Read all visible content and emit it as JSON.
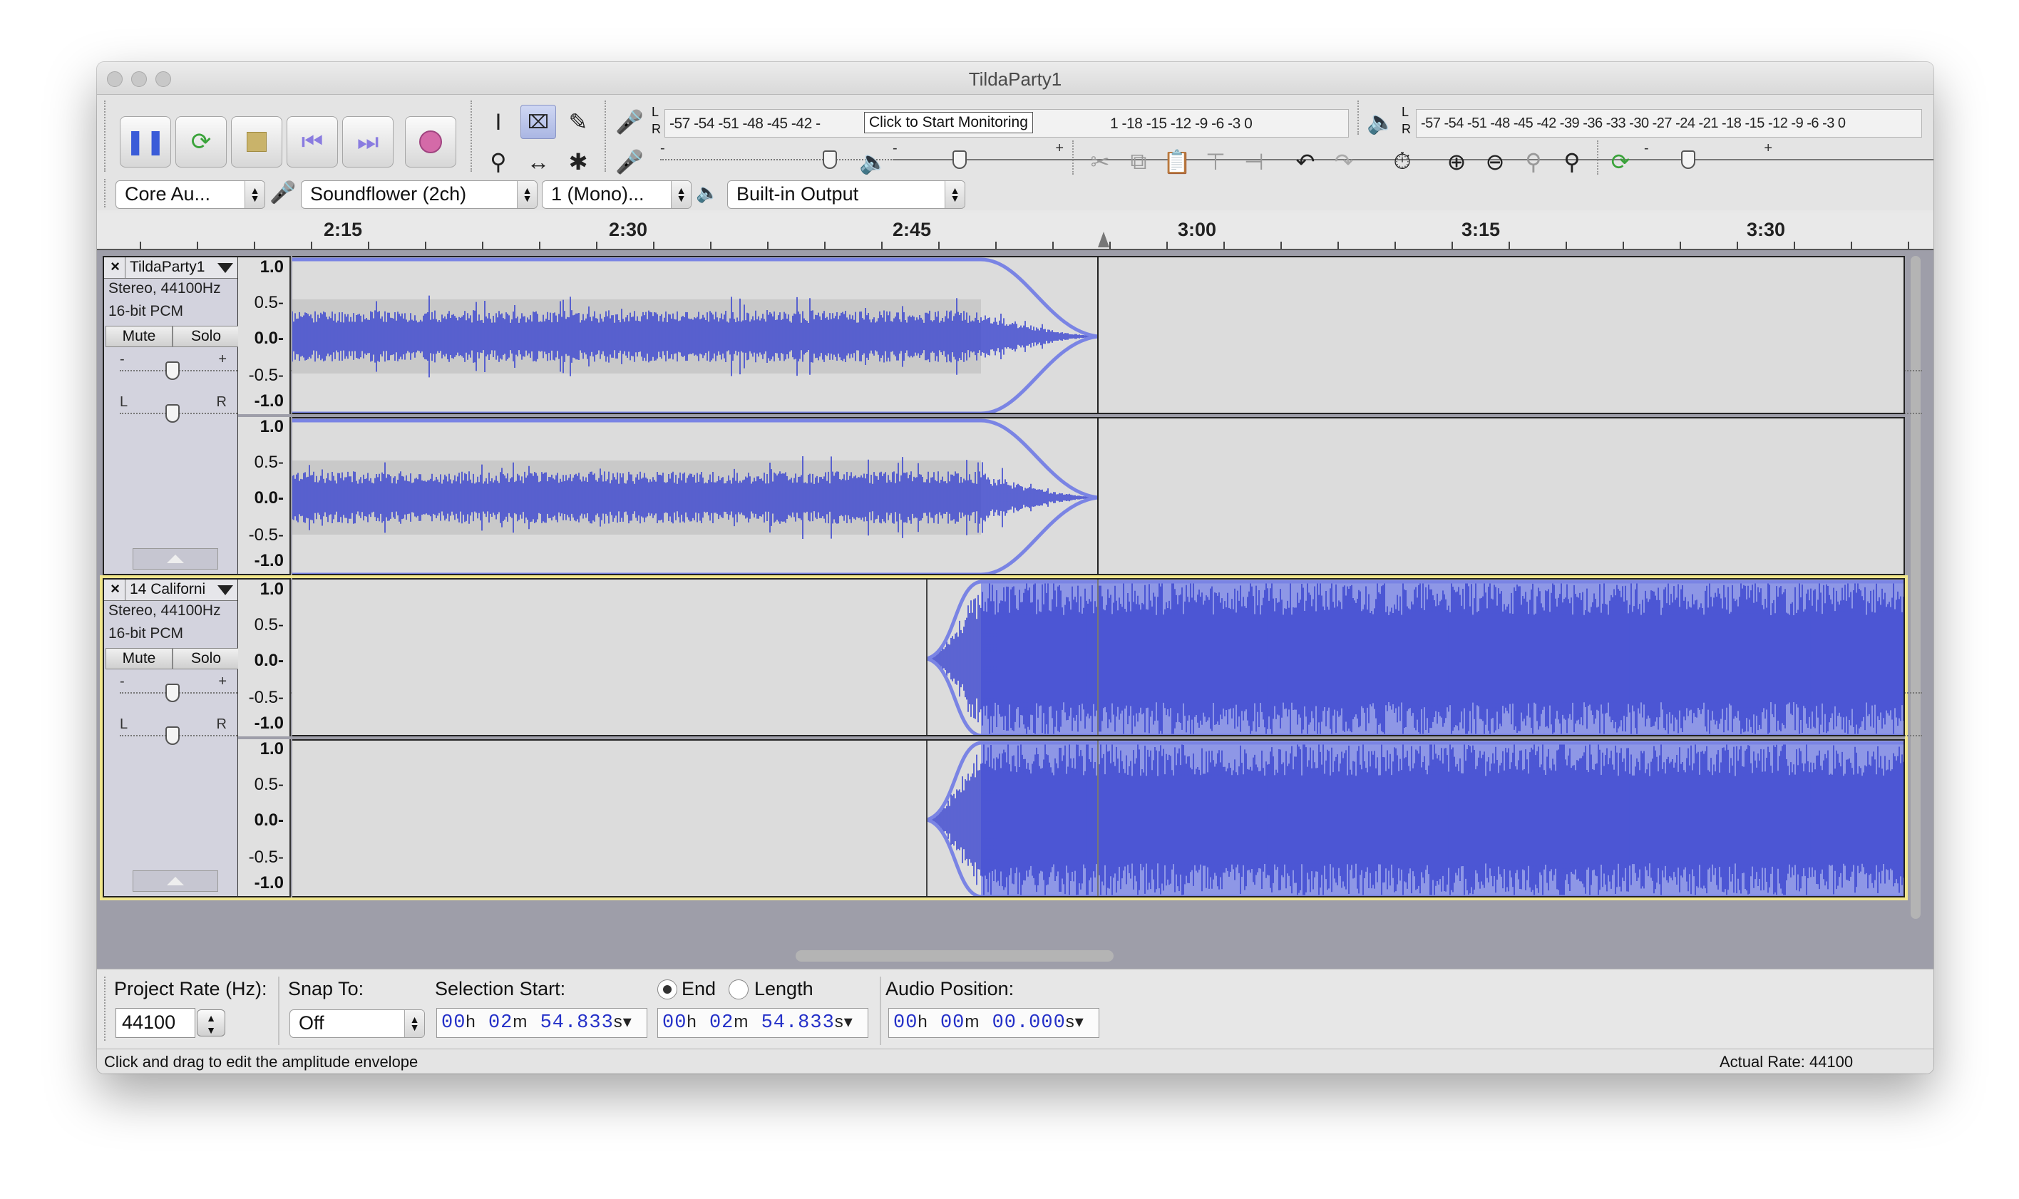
{
  "window": {
    "title": "TildaParty1"
  },
  "transport": {
    "pause": "pause-icon",
    "loop": "loop-icon",
    "stop": "stop-icon",
    "skip_start": "skip-start-icon",
    "skip_end": "skip-end-icon",
    "record": "record-icon"
  },
  "meters": {
    "record_scale": "-57 -54 -51 -48 -45 -42 -",
    "record_scale_tail": "1 -18 -15 -12  -9  -6  -3  0",
    "record_tooltip": "Click to Start Monitoring",
    "play_scale": "-57 -54 -51 -48 -45 -42 -39 -36 -33 -30 -27 -24 -21 -18 -15 -12  -9  -6  -3  0",
    "lr_top": "L",
    "lr_bottom": "R"
  },
  "devices": {
    "host": "Core Au...",
    "input_device": "Soundflower (2ch)",
    "channels": "1 (Mono)...",
    "output_device": "Built-in Output"
  },
  "ruler": {
    "labels": [
      "2:15",
      "2:30",
      "2:45",
      "3:00",
      "3:15",
      "3:30"
    ]
  },
  "tracks": [
    {
      "name": "TildaParty1",
      "format": "Stereo, 44100Hz",
      "bits": "16-bit PCM",
      "mute": "Mute",
      "solo": "Solo",
      "gain_minus": "-",
      "gain_plus": "+",
      "pan_left": "L",
      "pan_right": "R",
      "scale": [
        "1.0",
        "0.5-",
        "0.0-",
        "-0.5-",
        "-1.0"
      ]
    },
    {
      "name": "14 Californi",
      "format": "Stereo, 44100Hz",
      "bits": "16-bit PCM",
      "mute": "Mute",
      "solo": "Solo",
      "gain_minus": "-",
      "gain_plus": "+",
      "pan_left": "L",
      "pan_right": "R",
      "scale": [
        "1.0",
        "0.5-",
        "0.0-",
        "-0.5-",
        "-1.0"
      ]
    }
  ],
  "selection": {
    "project_rate_label": "Project Rate (Hz):",
    "project_rate": "44100",
    "snap_label": "Snap To:",
    "snap_value": "Off",
    "sel_start_label": "Selection Start:",
    "end_label": "End",
    "length_label": "Length",
    "audio_pos_label": "Audio Position:",
    "sel_start": {
      "h": "00",
      "m": "02",
      "s": "54.833"
    },
    "sel_end": {
      "h": "00",
      "m": "02",
      "s": "54.833"
    },
    "audio_pos": {
      "h": "00",
      "m": "00",
      "s": "00.000"
    },
    "unit_h": "h",
    "unit_m": "m",
    "unit_s": "s"
  },
  "status": {
    "message": "Click and drag to edit the amplitude envelope",
    "actual_rate": "Actual Rate: 44100"
  }
}
